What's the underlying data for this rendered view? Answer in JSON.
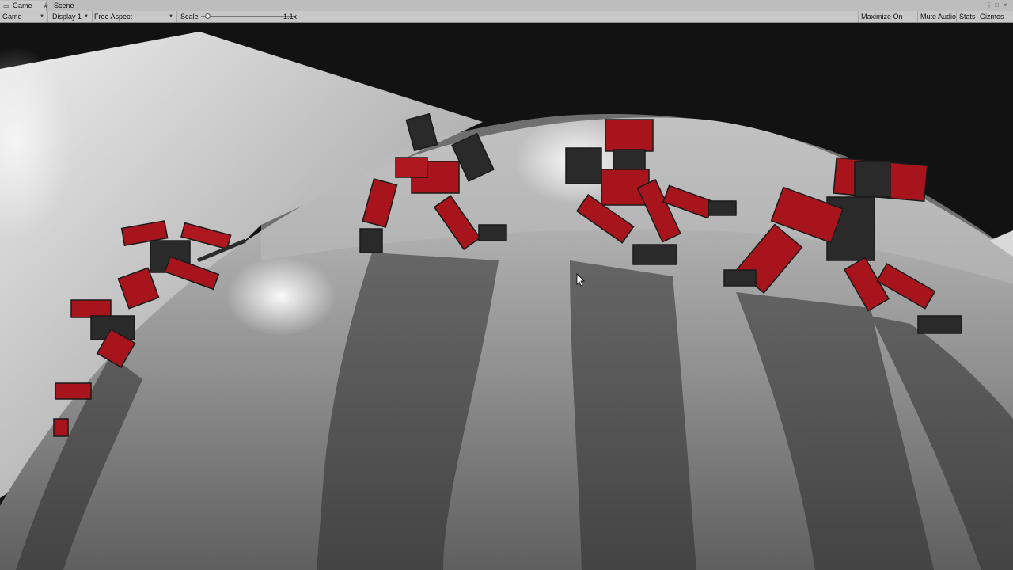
{
  "tabs": [
    {
      "label": "Game",
      "icon": "gamepad-icon",
      "active": true
    },
    {
      "label": "Scene",
      "icon": "grid-icon",
      "active": false
    }
  ],
  "toolbar": {
    "game_dropdown": "Game",
    "display_dropdown": "Display 1",
    "aspect_dropdown": "Free Aspect",
    "scale_label": "Scale",
    "scale_value": "1.1x",
    "maximize_on_play": "Maximize On Play",
    "mute_audio": "Mute Audio",
    "stats": "Stats",
    "gizmos": "Gizmos"
  },
  "scene": {
    "robot_count": 6,
    "colors": {
      "floor": "#8f8f8f",
      "background": "#121212",
      "robot_red": "#a8141c",
      "robot_dark": "#2a2a2a"
    }
  }
}
